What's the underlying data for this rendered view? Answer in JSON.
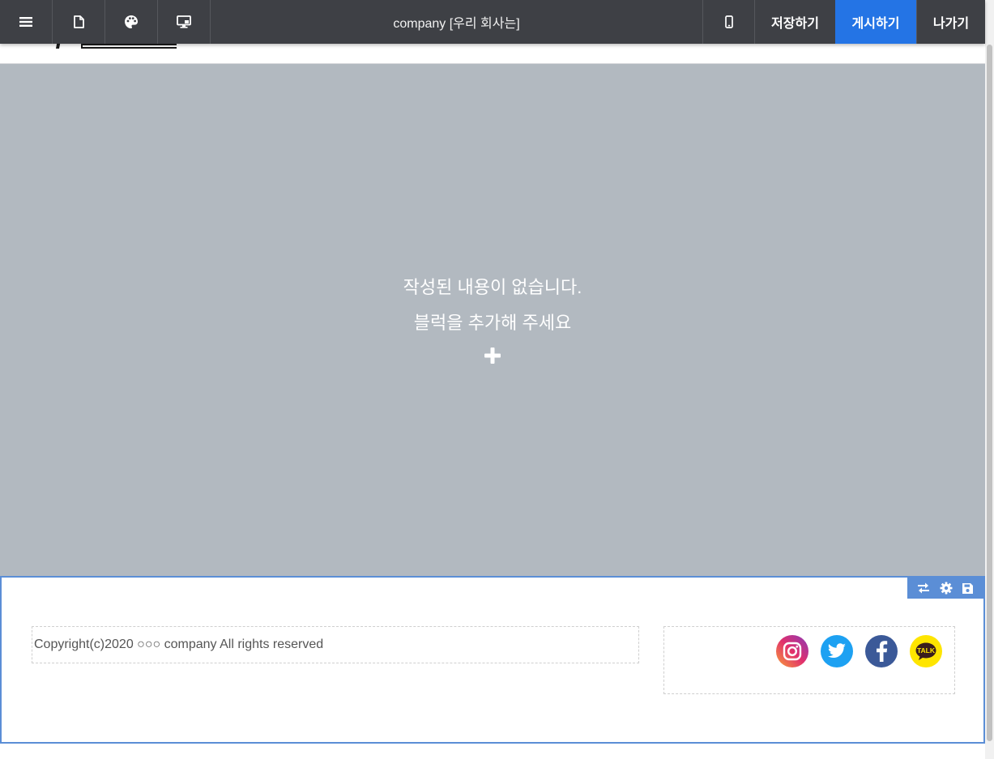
{
  "toolbar": {
    "title": "company [우리 회사는]",
    "icons": [
      "menu-icon",
      "page-icon",
      "palette-icon",
      "desktop-icon",
      "mobile-icon"
    ],
    "save_label": "저장하기",
    "publish_label": "게시하기",
    "exit_label": "나가기",
    "publish_color": "#2474e5",
    "bg_color": "#3e4045"
  },
  "canvas": {
    "empty_line1": "작성된 내용이 없습니다.",
    "empty_line2": "블럭을 추가해 주세요",
    "add_icon": "plus-icon",
    "bg_color": "#b2b9c0"
  },
  "footer": {
    "copyright": "Copyright(c)2020 ○○○ company All rights reserved",
    "tools": [
      "swap-icon",
      "gear-icon",
      "save-icon"
    ],
    "social": [
      "instagram-icon",
      "twitter-icon",
      "facebook-icon",
      "kakaotalk-icon"
    ],
    "kakao_label": "TALK",
    "border_color": "#5b8ed6"
  }
}
